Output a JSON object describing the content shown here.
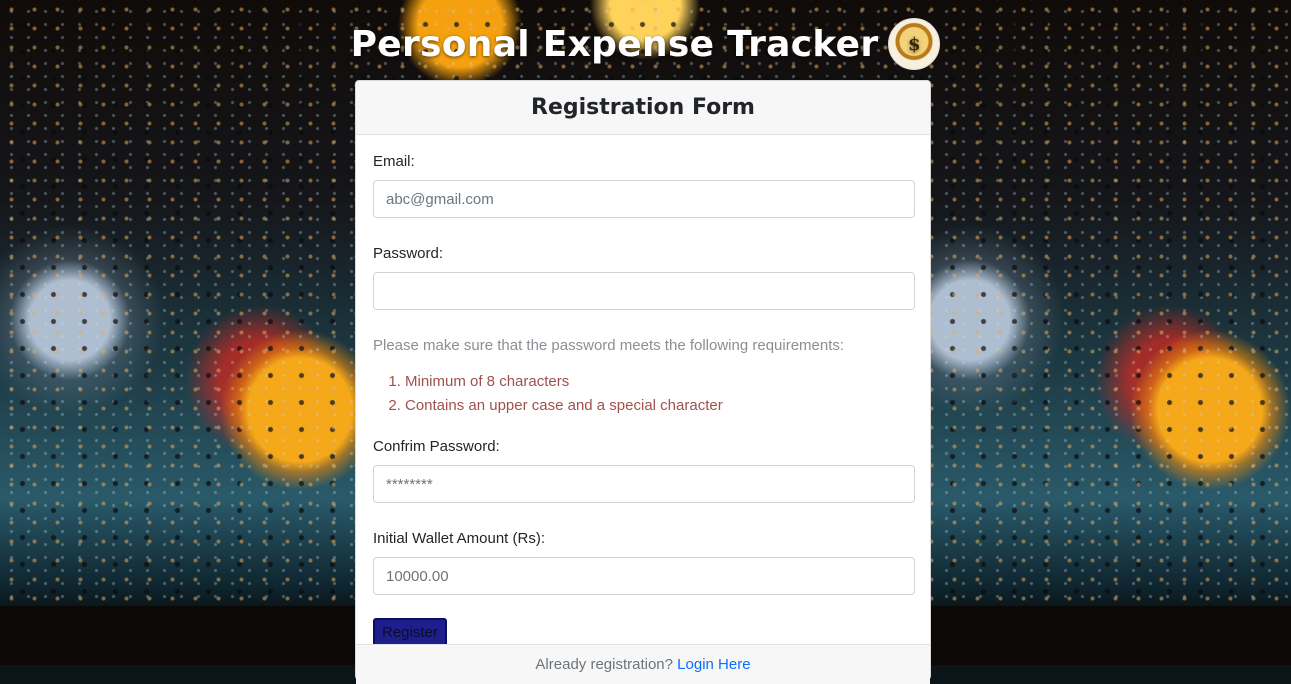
{
  "header": {
    "title": "Personal Expense Tracker",
    "logo_glyph": "$",
    "logo_icon": "money-bag-icon"
  },
  "form": {
    "title": "Registration Form",
    "email_label": "Email:",
    "email_placeholder": "abc@gmail.com",
    "password_label": "Password:",
    "password_placeholder": "",
    "requirements_intro": "Please make sure that the password meets the following requirements:",
    "requirements": [
      "Minimum of 8 characters",
      "Contains an upper case and a special character"
    ],
    "confirm_label": "Confrim Password:",
    "confirm_placeholder": "********",
    "wallet_label": "Initial Wallet Amount (Rs):",
    "wallet_placeholder": "10000.00",
    "register_label": "Register"
  },
  "footer": {
    "text": "Already registration? ",
    "link": "Login Here"
  },
  "colors": {
    "button_bg": "#1e1e8c",
    "requirement_text": "#a1504e",
    "hint_text": "#8a8f94"
  }
}
